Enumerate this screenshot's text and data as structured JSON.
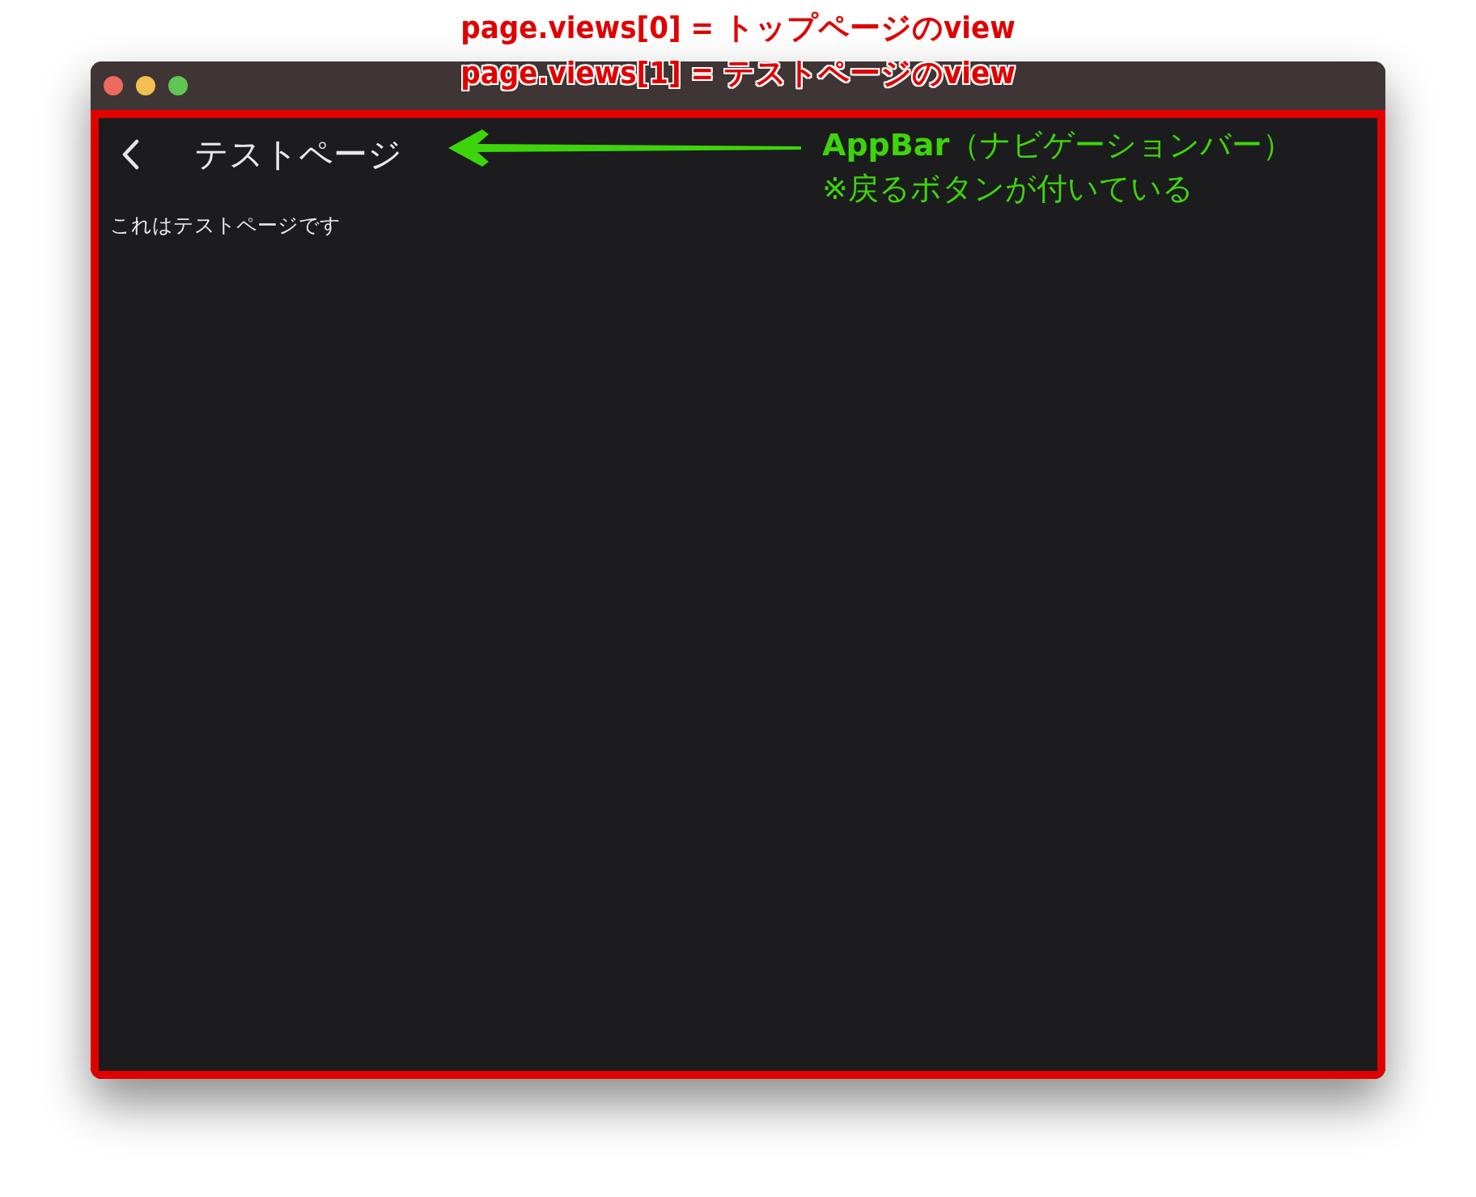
{
  "annotations": {
    "title_lines": [
      "page.views[0] = トップページのview",
      "page.views[1] = テストページのview"
    ],
    "appbar_note": [
      "**AppBar**（ナビゲーションバー）",
      "※戻るボタンが付いている"
    ]
  },
  "window": {
    "buttons": [
      {
        "color": "#ed6a5e"
      },
      {
        "color": "#f5bf4f"
      },
      {
        "color": "#61c554"
      }
    ]
  },
  "app_bar": {
    "title": "テストページ"
  },
  "body_text": "これはテストページです"
}
